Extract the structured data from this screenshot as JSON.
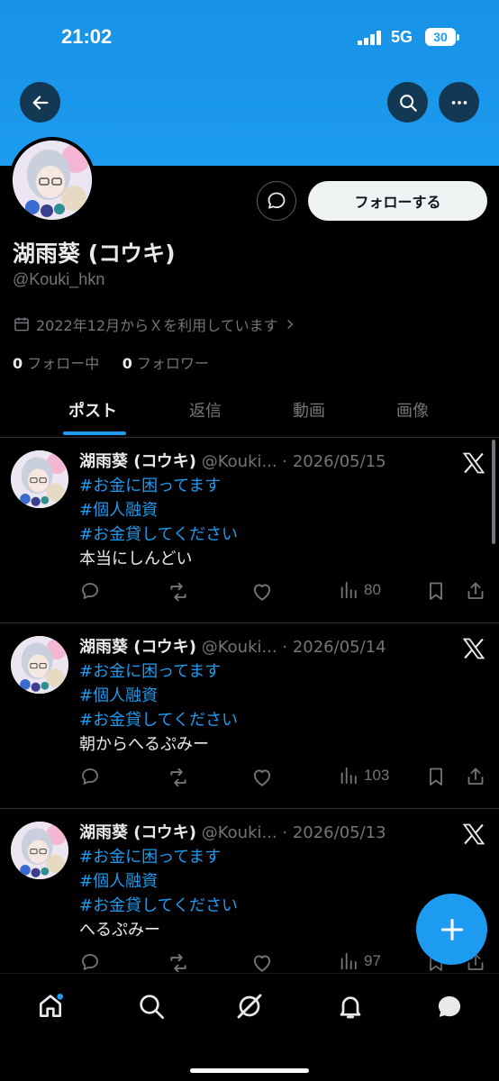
{
  "status_bar": {
    "time": "21:02",
    "network": "5G",
    "battery": "30"
  },
  "profile": {
    "name": "湖雨葵 (コウキ)",
    "handle": "@Kouki_hkn",
    "joined": "2022年12月からＸを利用しています",
    "following_count": "0",
    "following_label": "フォロー中",
    "followers_count": "0",
    "followers_label": "フォロワー",
    "follow_button": "フォローする"
  },
  "tabs": [
    {
      "label": "ポスト",
      "active": true
    },
    {
      "label": "返信"
    },
    {
      "label": "動画"
    },
    {
      "label": "画像"
    }
  ],
  "posts": [
    {
      "name": "湖雨葵 (コウキ)",
      "handle": "@Kouki...",
      "date": "· 2026/05/15",
      "tags": [
        "#お金に困ってます",
        "#個人融資",
        "#お金貸してください"
      ],
      "text": "本当にしんどい",
      "views": "80"
    },
    {
      "name": "湖雨葵 (コウキ)",
      "handle": "@Kouki...",
      "date": "· 2026/05/14",
      "tags": [
        "#お金に困ってます",
        "#個人融資",
        "#お金貸してください"
      ],
      "text": "朝からへるぷみー",
      "views": "103"
    },
    {
      "name": "湖雨葵 (コウキ)",
      "handle": "@Kouki...",
      "date": "· 2026/05/13",
      "tags": [
        "#お金に困ってます",
        "#個人融資",
        "#お金貸してください"
      ],
      "text": "へるぷみー",
      "views": "97"
    }
  ],
  "icons": {
    "back": "arrow-left-icon",
    "search": "search-icon",
    "more": "more-icon",
    "message": "message-icon",
    "calendar": "calendar-icon",
    "reply": "reply-icon",
    "repost": "repost-icon",
    "like": "heart-icon",
    "views": "views-icon",
    "bookmark": "bookmark-icon",
    "share": "share-icon",
    "compose": "plus-icon",
    "nav": [
      "home-icon",
      "search-icon",
      "grok-icon",
      "bell-icon",
      "messages-icon"
    ]
  },
  "colors": {
    "accent": "#1d9bf0",
    "background": "#000000",
    "text": "#e7e9ea",
    "muted": "#71767b"
  }
}
